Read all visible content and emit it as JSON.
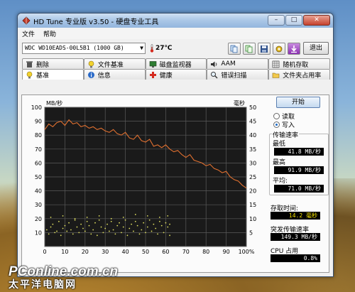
{
  "window": {
    "title": "HD Tune 专业版 v3.50 - 硬盘专业工具",
    "min_label": "–",
    "max_label": "□",
    "close_label": "✕"
  },
  "menu": {
    "file": "文件",
    "help": "帮助"
  },
  "toolbar": {
    "drive": "WDC WD10EADS-00L5B1 (1000 GB)",
    "temperature": "27℃",
    "exit_label": "退出",
    "buttons": [
      "copy-icon",
      "copy-text-icon",
      "save-icon",
      "options-icon",
      "download-icon"
    ]
  },
  "tabs": {
    "back_row": [
      "删除",
      "文件基准",
      "磁盘监视器",
      "AAM",
      "随机存取"
    ],
    "front_row": [
      "基准",
      "信息",
      "健康",
      "错误扫描",
      "文件夹占用率"
    ],
    "active": "基准"
  },
  "side": {
    "start_label": "开始",
    "read_label": "读取",
    "write_label": "写入",
    "selected_mode": "写入",
    "transfer_title": "传输速率",
    "min_label": "最低",
    "min_value": "41.8 MB/秒",
    "max_label": "最高",
    "max_value": "91.9 MB/秒",
    "avg_label": "平均:",
    "avg_value": "71.0 MB/秒",
    "access_label": "存取时间:",
    "access_value": "14.2 毫秒",
    "burst_label": "突发传输速率",
    "burst_value": "149.3 MB/秒",
    "cpu_label": "CPU 占用",
    "cpu_value": "0.8%"
  },
  "watermark": {
    "main": "PConline.com.cn",
    "sub": "太平洋电脑网"
  },
  "colors": {
    "plot_bg": "#1a1a1a",
    "grid": "#5a5a5a",
    "transfer_line": "#e07030",
    "access_points": "#e0e060"
  },
  "chart_data": {
    "type": "line",
    "y_left_unit": "MB/秒",
    "y_right_unit": "毫秒",
    "y_left_ticks": [
      10,
      20,
      30,
      40,
      50,
      60,
      70,
      80,
      90,
      100
    ],
    "y_right_ticks": [
      5,
      10,
      15,
      20,
      25,
      30,
      35,
      40,
      45,
      50
    ],
    "x_ticks": [
      "0",
      "10",
      "20",
      "30",
      "40",
      "50",
      "60",
      "70",
      "80",
      "90",
      "100%"
    ],
    "ylim_left": [
      0,
      100
    ],
    "ylim_right": [
      0,
      50
    ],
    "xlim": [
      0,
      100
    ],
    "grid": true,
    "series": [
      {
        "x": [
          0,
          2,
          4,
          6,
          8,
          10,
          12,
          14,
          16,
          18,
          20,
          22,
          24,
          26,
          28,
          30,
          32,
          34,
          36,
          38,
          40,
          42,
          44,
          46,
          48,
          50,
          52,
          54,
          56,
          58,
          60,
          62,
          64,
          66,
          68,
          70,
          72,
          74,
          76,
          78,
          80,
          82,
          84,
          86,
          88,
          90,
          92,
          94,
          96,
          98,
          100
        ],
        "values": [
          84,
          88,
          86,
          89,
          90,
          87,
          91,
          88,
          89,
          86,
          87,
          85,
          86,
          84,
          85,
          83,
          82,
          84,
          81,
          80,
          82,
          78,
          77,
          80,
          76,
          75,
          77,
          72,
          73,
          71,
          73,
          70,
          68,
          69,
          66,
          64,
          66,
          62,
          61,
          60,
          58,
          59,
          56,
          55,
          53,
          54,
          50,
          48,
          47,
          44,
          42
        ]
      }
    ],
    "access_scatter": {
      "x": [
        1,
        3,
        4,
        6,
        7,
        9,
        10,
        12,
        13,
        15,
        16,
        18,
        19,
        21,
        22,
        24,
        25,
        27,
        28,
        30,
        31,
        33,
        34,
        36,
        37,
        39,
        40,
        42,
        43,
        45,
        46,
        48,
        49,
        51,
        52,
        54,
        55,
        57,
        58,
        60,
        61,
        62,
        2,
        5,
        8,
        11,
        14,
        17,
        20,
        23,
        26,
        29,
        32,
        35,
        38,
        41,
        44,
        47,
        50,
        53,
        56,
        59,
        62,
        3,
        9,
        15,
        21,
        27,
        33,
        39,
        45,
        51,
        57,
        61
      ],
      "values": [
        12,
        14,
        16,
        11,
        18,
        13,
        15,
        17,
        12,
        19,
        14,
        16,
        13,
        18,
        15,
        12,
        17,
        19,
        14,
        13,
        16,
        18,
        12,
        15,
        17,
        14,
        19,
        13,
        16,
        18,
        15,
        12,
        17,
        14,
        19,
        16,
        13,
        18,
        15,
        17,
        14,
        16,
        9,
        10,
        8,
        11,
        9,
        10,
        11,
        9,
        8,
        10,
        11,
        9,
        10,
        8,
        11,
        9,
        10,
        11,
        9,
        10,
        8,
        21,
        22,
        20,
        21,
        22,
        20,
        21,
        23,
        22,
        21,
        22
      ]
    }
  }
}
